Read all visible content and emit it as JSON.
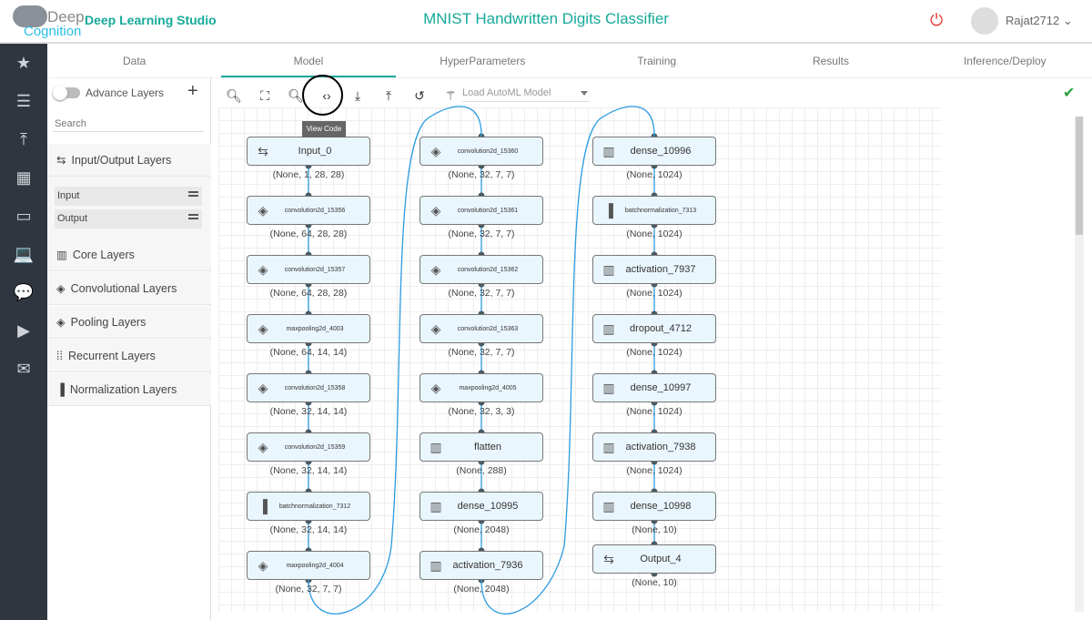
{
  "header": {
    "logo_top": "Deep",
    "logo_bottom": "Cognition",
    "studio": "Deep Learning Studio",
    "title": "MNIST Handwritten Digits Classifier",
    "user": "Rajat2712 ⌄"
  },
  "sidebar": {
    "icons": [
      "folder-star-icon",
      "database-icon",
      "upload-icon",
      "grid-icon",
      "folder-icon",
      "laptop-icon",
      "chat-icon",
      "play-icon",
      "mail-icon"
    ]
  },
  "tabs": [
    {
      "label": "Data"
    },
    {
      "label": "Model",
      "active": true
    },
    {
      "label": "HyperParameters"
    },
    {
      "label": "Training"
    },
    {
      "label": "Results"
    },
    {
      "label": "Inference/Deploy"
    }
  ],
  "left_panel": {
    "advance_layers": "Advance Layers",
    "search_placeholder": "Search",
    "groups": [
      "Input/Output Layers",
      "Core Layers",
      "Convolutional Layers",
      "Pooling Layers",
      "Recurrent Layers",
      "Normalization Layers"
    ],
    "io_items": [
      "Input",
      "Output"
    ]
  },
  "toolbar": {
    "tooltip": "View Code",
    "automl_placeholder": "Load AutoML Model"
  },
  "columns": [
    [
      {
        "name": "Input_0",
        "type": "io",
        "shape": "(None, 1, 28, 28)"
      },
      {
        "name": "convolution2d_15356",
        "type": "conv",
        "shape": "(None, 64, 28, 28)"
      },
      {
        "name": "convolution2d_15357",
        "type": "conv",
        "shape": "(None, 64, 28, 28)"
      },
      {
        "name": "maxpooling2d_4003",
        "type": "conv",
        "shape": "(None, 64, 14, 14)"
      },
      {
        "name": "convolution2d_15358",
        "type": "conv",
        "shape": "(None, 32, 14, 14)"
      },
      {
        "name": "convolution2d_15359",
        "type": "conv",
        "shape": "(None, 32, 14, 14)"
      },
      {
        "name": "batchnormalization_7312",
        "type": "norm",
        "shape": "(None, 32, 14, 14)"
      },
      {
        "name": "maxpooling2d_4004",
        "type": "conv",
        "shape": "(None, 32, 7, 7)"
      }
    ],
    [
      {
        "name": "convolution2d_15360",
        "type": "conv",
        "shape": "(None, 32, 7, 7)"
      },
      {
        "name": "convolution2d_15361",
        "type": "conv",
        "shape": "(None, 32, 7, 7)"
      },
      {
        "name": "convolution2d_15362",
        "type": "conv",
        "shape": "(None, 32, 7, 7)"
      },
      {
        "name": "convolution2d_15363",
        "type": "conv",
        "shape": "(None, 32, 7, 7)"
      },
      {
        "name": "maxpooling2d_4005",
        "type": "conv",
        "shape": "(None, 32, 3, 3)"
      },
      {
        "name": "flatten",
        "type": "core",
        "shape": "(None, 288)"
      },
      {
        "name": "dense_10995",
        "type": "core",
        "shape": "(None, 2048)"
      },
      {
        "name": "activation_7936",
        "type": "core",
        "shape": "(None, 2048)"
      }
    ],
    [
      {
        "name": "dense_10996",
        "type": "core",
        "shape": "(None, 1024)"
      },
      {
        "name": "batchnormalization_7313",
        "type": "norm",
        "shape": "(None, 1024)"
      },
      {
        "name": "activation_7937",
        "type": "core",
        "shape": "(None, 1024)"
      },
      {
        "name": "dropout_4712",
        "type": "core",
        "shape": "(None, 1024)"
      },
      {
        "name": "dense_10997",
        "type": "core",
        "shape": "(None, 1024)"
      },
      {
        "name": "activation_7938",
        "type": "core",
        "shape": "(None, 1024)"
      },
      {
        "name": "dense_10998",
        "type": "core",
        "shape": "(None, 10)"
      },
      {
        "name": "Output_4",
        "type": "io",
        "shape": "(None, 10)"
      }
    ]
  ],
  "colors": {
    "accent": "#16a99a",
    "link": "#2b9be0",
    "sidebar": "#2f3640"
  }
}
